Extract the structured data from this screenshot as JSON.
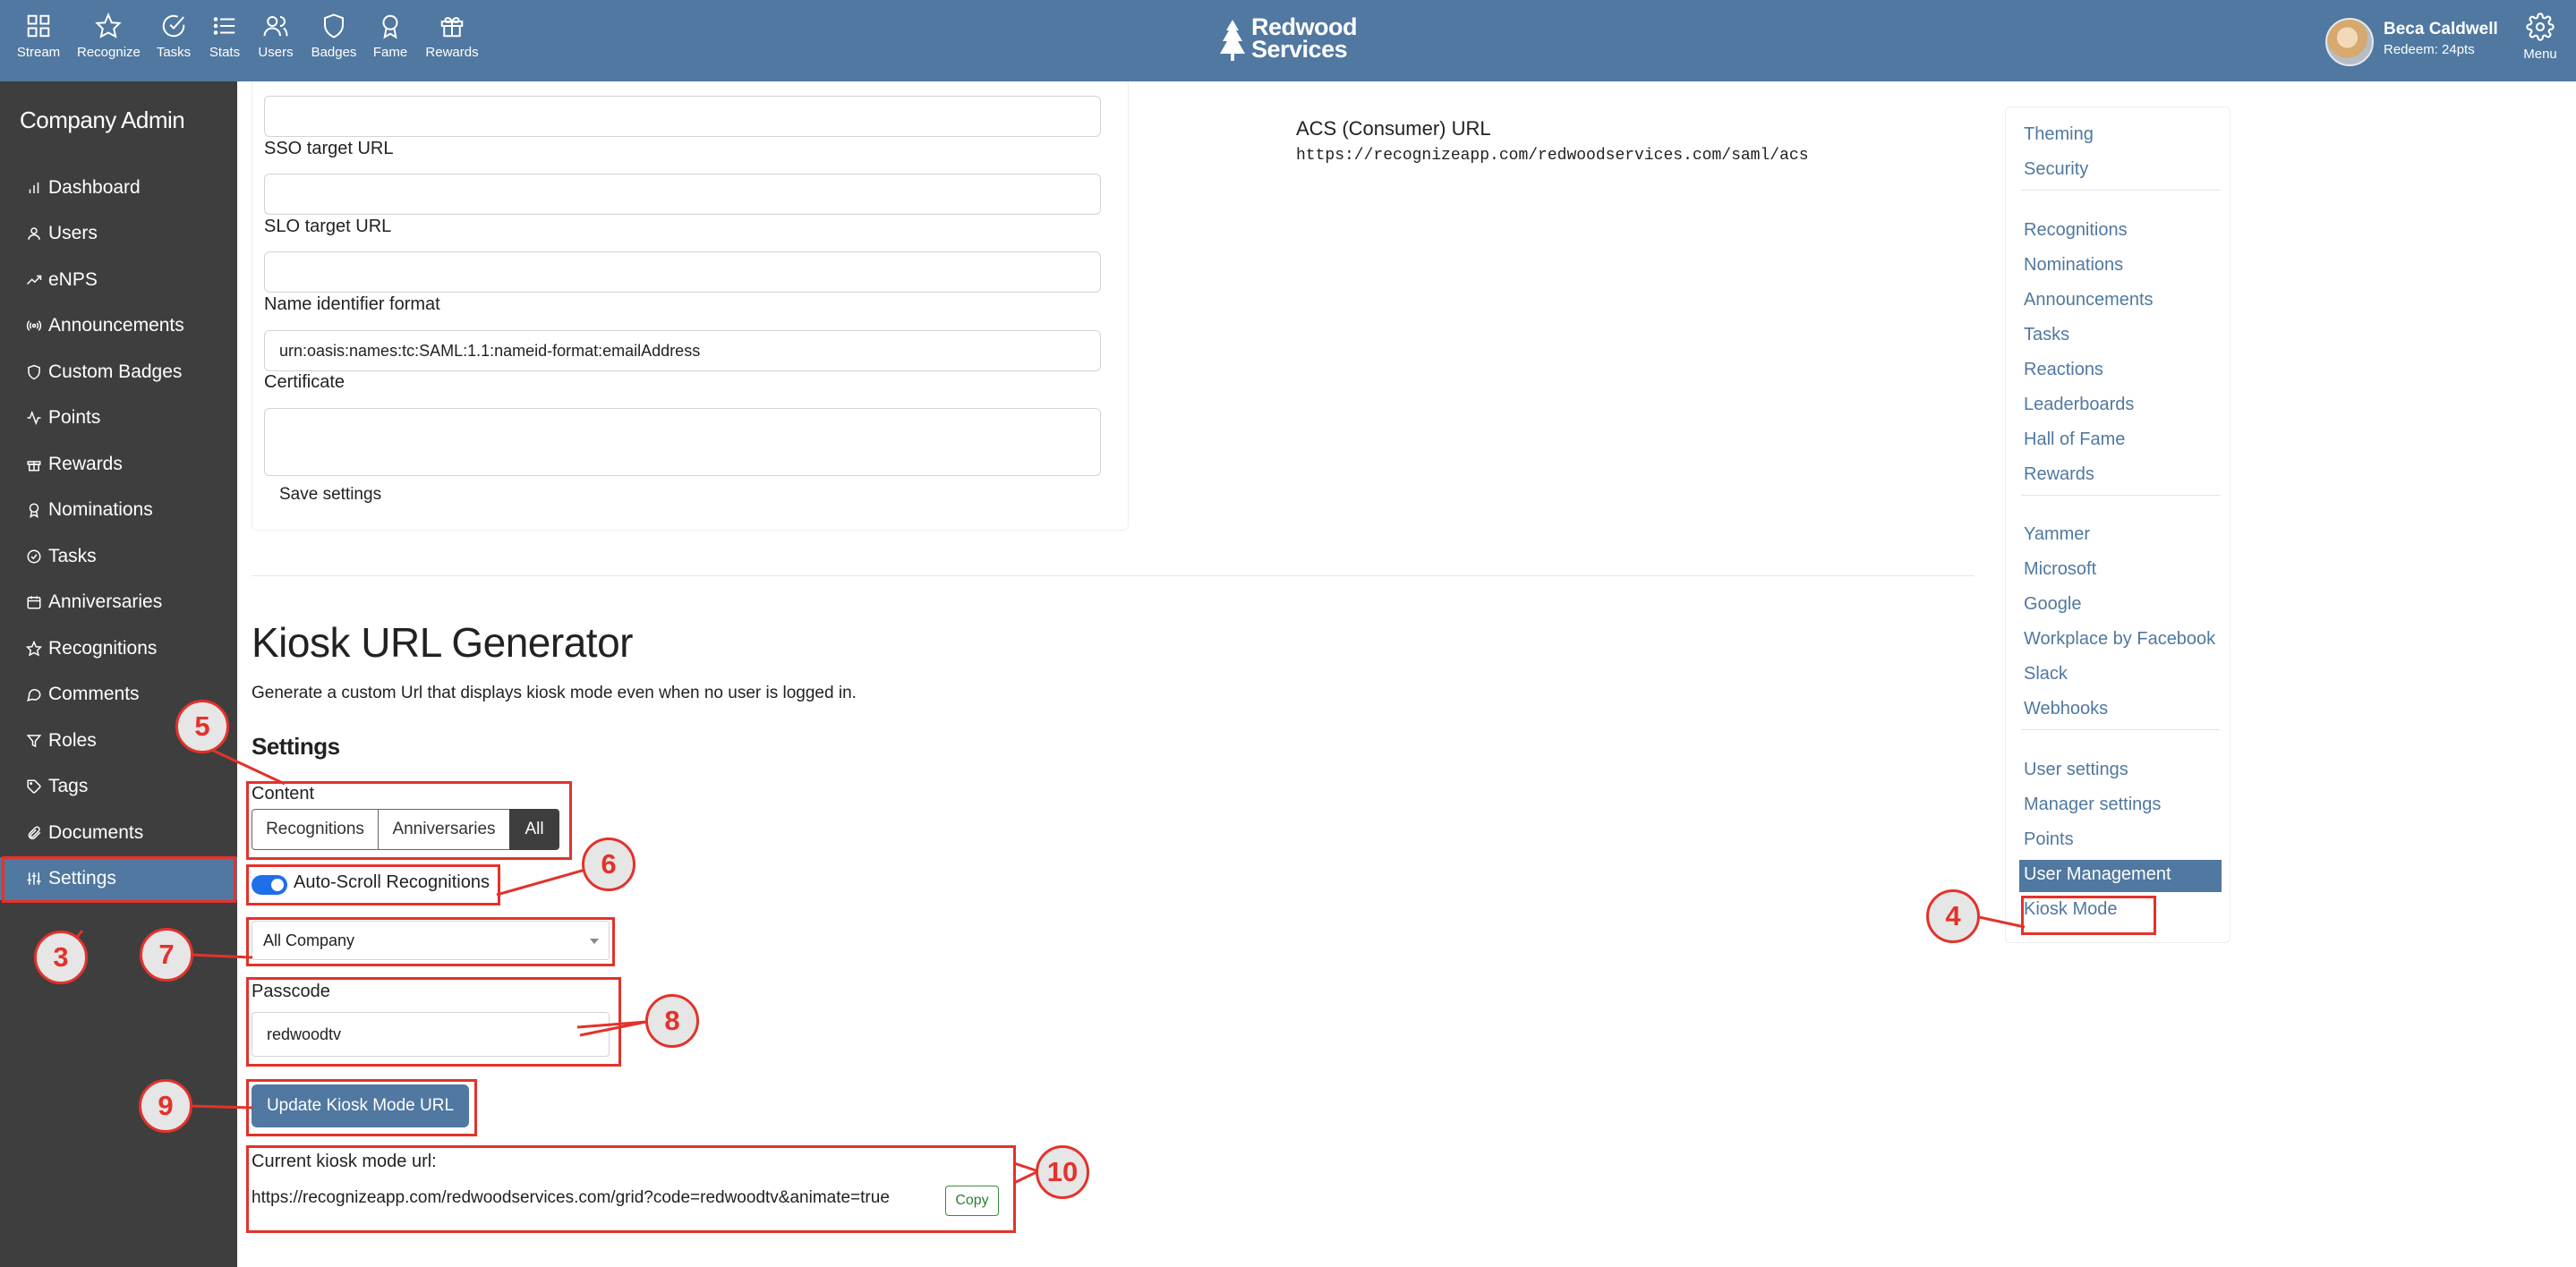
{
  "topnav": {
    "items": [
      {
        "label": "Stream",
        "icon": "grid-icon"
      },
      {
        "label": "Recognize",
        "icon": "star-icon"
      },
      {
        "label": "Tasks",
        "icon": "check-circle-icon"
      },
      {
        "label": "Stats",
        "icon": "list-icon"
      },
      {
        "label": "Users",
        "icon": "users-icon"
      },
      {
        "label": "Badges",
        "icon": "shield-icon"
      },
      {
        "label": "Fame",
        "icon": "award-icon"
      },
      {
        "label": "Rewards",
        "icon": "gift-icon"
      }
    ],
    "logo_line1": "Redwood",
    "logo_line2": "Services",
    "user_name": "Beca Caldwell",
    "user_redeem": "Redeem: 24pts",
    "menu_label": "Menu"
  },
  "sidebar": {
    "title": "Company Admin",
    "items": [
      {
        "label": "Dashboard",
        "icon": "bar-chart-icon"
      },
      {
        "label": "Users",
        "icon": "user-icon"
      },
      {
        "label": "eNPS",
        "icon": "trend-icon"
      },
      {
        "label": "Announcements",
        "icon": "broadcast-icon"
      },
      {
        "label": "Custom Badges",
        "icon": "shield-icon"
      },
      {
        "label": "Points",
        "icon": "activity-icon"
      },
      {
        "label": "Rewards",
        "icon": "gift-icon"
      },
      {
        "label": "Nominations",
        "icon": "award-icon"
      },
      {
        "label": "Tasks",
        "icon": "check-circle-icon"
      },
      {
        "label": "Anniversaries",
        "icon": "calendar-icon"
      },
      {
        "label": "Recognitions",
        "icon": "star-icon"
      },
      {
        "label": "Comments",
        "icon": "comment-icon"
      },
      {
        "label": "Roles",
        "icon": "filter-icon"
      },
      {
        "label": "Tags",
        "icon": "tag-icon"
      },
      {
        "label": "Documents",
        "icon": "paperclip-icon"
      },
      {
        "label": "Settings",
        "icon": "sliders-icon",
        "active": true
      }
    ]
  },
  "sso": {
    "sso_target_label": "SSO target URL",
    "slo_target_label": "SLO target URL",
    "name_id_label": "Name identifier format",
    "name_id_value": "urn:oasis:names:tc:SAML:1.1:nameid-format:emailAddress",
    "certificate_label": "Certificate",
    "save_label": "Save settings",
    "acs_title": "ACS (Consumer) URL",
    "acs_url": "https://recognizeapp.com/redwoodservices.com/saml/acs"
  },
  "kiosk": {
    "title": "Kiosk URL Generator",
    "description": "Generate a custom Url that displays kiosk mode even when no user is logged in.",
    "settings_heading": "Settings",
    "content_label": "Content",
    "content_options": [
      "Recognitions",
      "Anniversaries",
      "All"
    ],
    "content_selected": "All",
    "autoscroll_label": "Auto-Scroll Recognitions",
    "autoscroll_on": true,
    "scope_value": "All Company",
    "passcode_label": "Passcode",
    "passcode_value": "redwoodtv",
    "update_button": "Update Kiosk Mode URL",
    "current_url_label": "Current kiosk mode url:",
    "current_url": "https://recognizeapp.com/redwoodservices.com/grid?code=redwoodtv&animate=true",
    "copy_label": "Copy"
  },
  "settings_nav": {
    "group1": [
      "Theming",
      "Security"
    ],
    "group2": [
      "Recognitions",
      "Nominations",
      "Announcements",
      "Tasks",
      "Reactions",
      "Leaderboards",
      "Hall of Fame",
      "Rewards"
    ],
    "group3": [
      "Yammer",
      "Microsoft",
      "Google",
      "Workplace by Facebook",
      "Slack",
      "Webhooks"
    ],
    "group4": [
      "User settings",
      "Manager settings",
      "Points",
      "User Management",
      "Kiosk Mode"
    ],
    "active": "User Management"
  },
  "annotations": [
    "3",
    "4",
    "5",
    "6",
    "7",
    "8",
    "9",
    "10"
  ],
  "colors": {
    "brand": "#5078a0",
    "sidebar": "#3e3e3e",
    "annotation": "#e3322b",
    "toggle": "#1f6feb"
  }
}
